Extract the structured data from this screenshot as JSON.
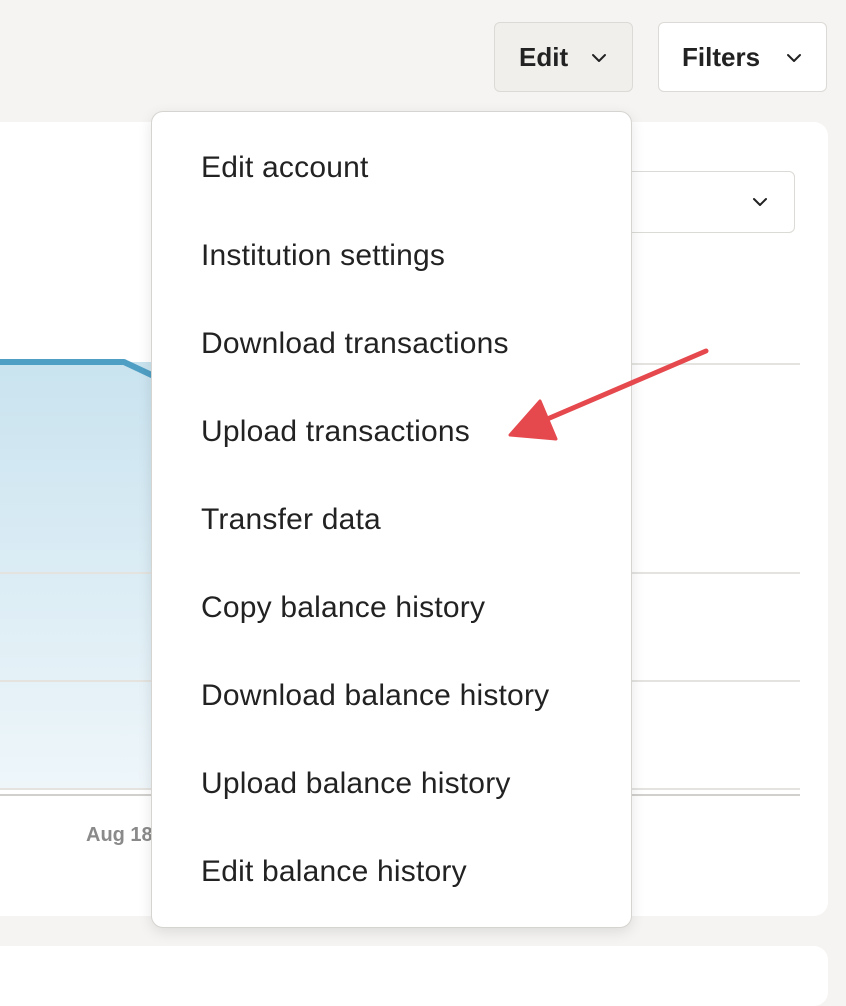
{
  "toolbar": {
    "edit_label": "Edit",
    "filters_label": "Filters"
  },
  "chart": {
    "x_tick_label": "Aug 18"
  },
  "edit_menu": {
    "items": [
      {
        "label": "Edit account"
      },
      {
        "label": "Institution settings"
      },
      {
        "label": "Download transactions"
      },
      {
        "label": "Upload transactions"
      },
      {
        "label": "Transfer data"
      },
      {
        "label": "Copy balance history"
      },
      {
        "label": "Download balance history"
      },
      {
        "label": "Upload balance history"
      },
      {
        "label": "Edit balance history"
      }
    ]
  },
  "annotation": {
    "arrow_color": "#e5484d",
    "points_to": "Upload transactions"
  },
  "colors": {
    "chart_line": "#4f9fc4",
    "chart_fill": "#cfe6f1",
    "background": "#f5f4f2"
  }
}
